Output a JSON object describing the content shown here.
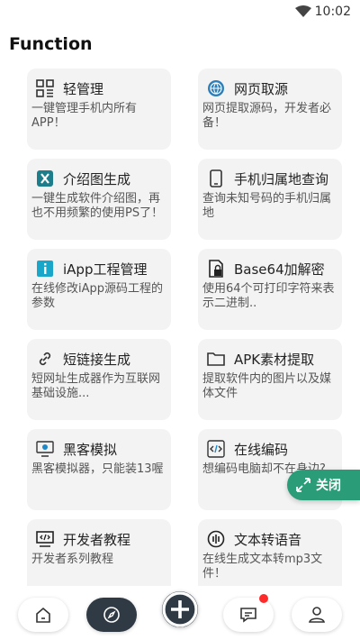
{
  "status_bar": {
    "time": "10:02",
    "wifi_icon": "wifi-icon"
  },
  "page": {
    "title": "Function"
  },
  "cards": [
    {
      "title": "轻管理",
      "desc": "一键管理手机内所有APP！",
      "icon": "grid-icon"
    },
    {
      "title": "网页取源",
      "desc": "网页提取源码，开发者必备！",
      "icon": "globe-icon"
    },
    {
      "title": "介绍图生成",
      "desc": "一键生成软件介绍图，再也不用频繁的使用PS了！",
      "icon": "excel-icon"
    },
    {
      "title": "手机归属地查询",
      "desc": "查询未知号码的手机归属地",
      "icon": "phone-icon"
    },
    {
      "title": "iApp工程管理",
      "desc": "在线修改iApp源码工程的参数",
      "icon": "info-icon"
    },
    {
      "title": "Base64加解密",
      "desc": "使用64个可打印字符来表示二进制..",
      "icon": "lock-doc-icon"
    },
    {
      "title": "短链接生成",
      "desc": "短网址生成器作为互联网基础设施...",
      "icon": "link-icon"
    },
    {
      "title": "APK素材提取",
      "desc": "提取软件内的图片以及媒体文件",
      "icon": "folder-icon"
    },
    {
      "title": "黑客模拟",
      "desc": "黑客模拟器，只能装13喔",
      "icon": "hacker-icon"
    },
    {
      "title": "在线编码",
      "desc": "想编码电脑却不在身边?",
      "icon": "code-file-icon"
    },
    {
      "title": "开发者教程",
      "desc": "开发者系列教程",
      "icon": "code-screen-icon"
    },
    {
      "title": "文本转语音",
      "desc": "在线生成文本转mp3文件！",
      "icon": "audio-icon"
    }
  ],
  "close_fab": {
    "label": "关闭",
    "icon": "collapse-arrows-icon",
    "color": "#2a9d78"
  },
  "bottom_nav": {
    "items": [
      {
        "name": "home",
        "icon": "home-icon"
      },
      {
        "name": "discover",
        "icon": "compass-icon",
        "active": true
      },
      {
        "name": "add",
        "icon": "plus-circle-icon"
      },
      {
        "name": "messages",
        "icon": "message-icon",
        "badge": true
      },
      {
        "name": "profile",
        "icon": "user-icon"
      }
    ]
  },
  "colors": {
    "card_bg": "#f3f3f3",
    "accent_dark": "#2f3a44",
    "badge": "#ff2b2b"
  }
}
